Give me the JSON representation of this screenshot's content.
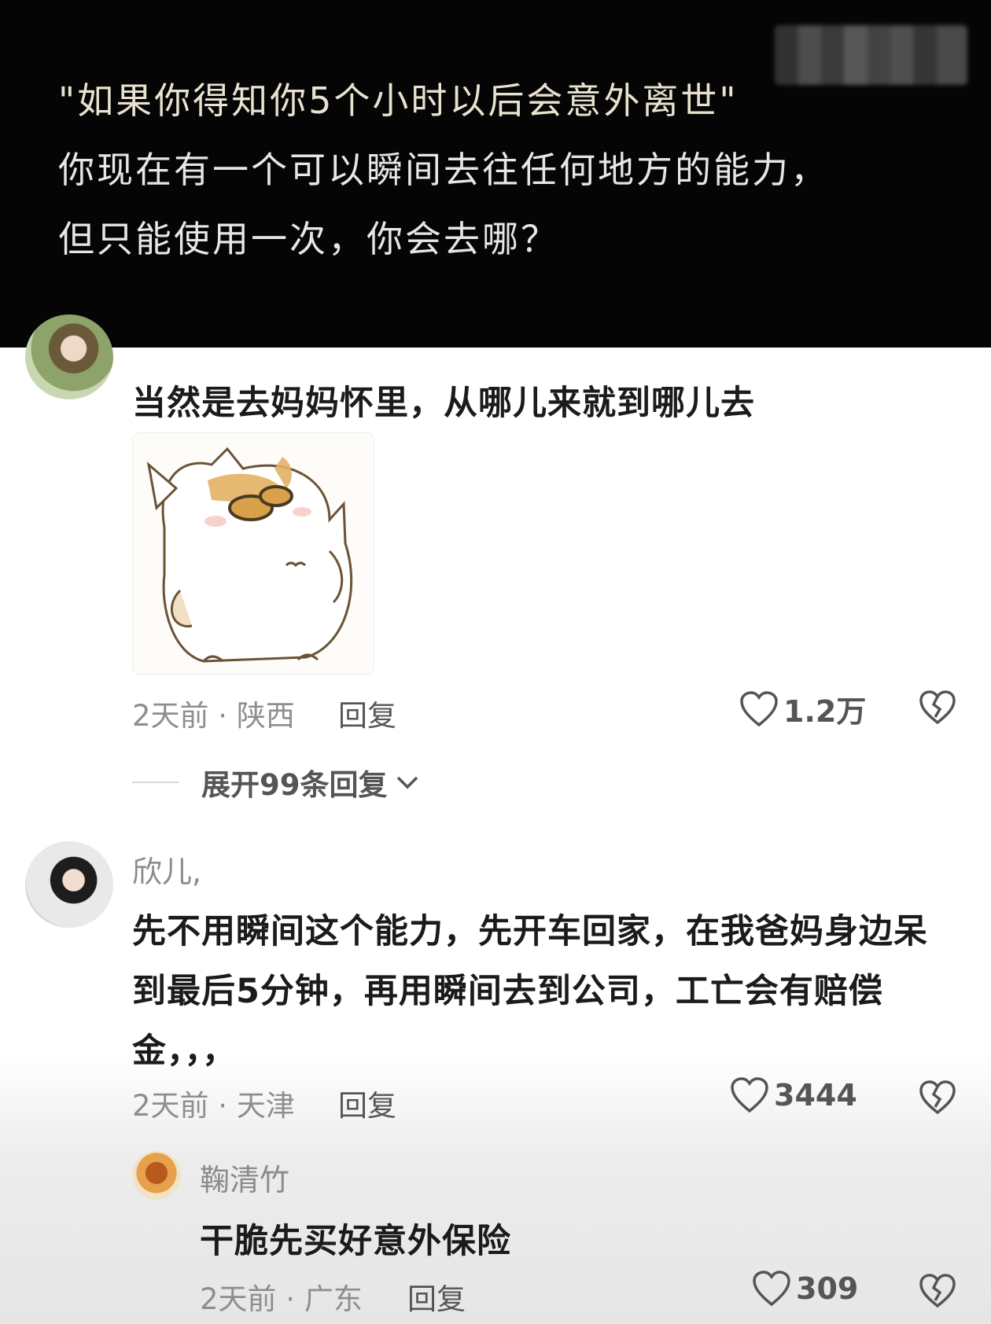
{
  "header": {
    "line1": "\"如果你得知你5个小时以后会意外离世\"",
    "line2": "你现在有一个可以瞬间去往任何地方的能力，",
    "line3": "但只能使用一次，你会去哪？"
  },
  "comments": [
    {
      "content": "当然是去妈妈怀里，从哪儿来就到哪儿去",
      "meta": "2天前 · 陕西",
      "reply_label": "回复",
      "likes": "1.2万",
      "expand_label": "展开99条回复"
    },
    {
      "username": "欣儿,",
      "content_line1": "先不用瞬间这个能力，先开车回家，在我爸妈身边呆",
      "content_line2": "到最后5分钟，再用瞬间去到公司，工亡会有赔偿",
      "content_line3": "金，，，",
      "meta": "2天前 · 天津",
      "reply_label": "回复",
      "likes": "3444"
    }
  ],
  "sub_comment": {
    "username": "鞠清竹",
    "content": "干脆先买好意外保险",
    "meta": "2天前 · 广东",
    "reply_label": "回复",
    "likes": "309"
  },
  "colors": {
    "header_bg": "#050505",
    "header_text": "#e6e6e6",
    "username": "#8b8b8b",
    "content": "#1b1b1b",
    "meta": "#8e8e8e"
  },
  "icons": [
    "heart-icon",
    "broken-heart-icon",
    "chevron-down-icon"
  ]
}
